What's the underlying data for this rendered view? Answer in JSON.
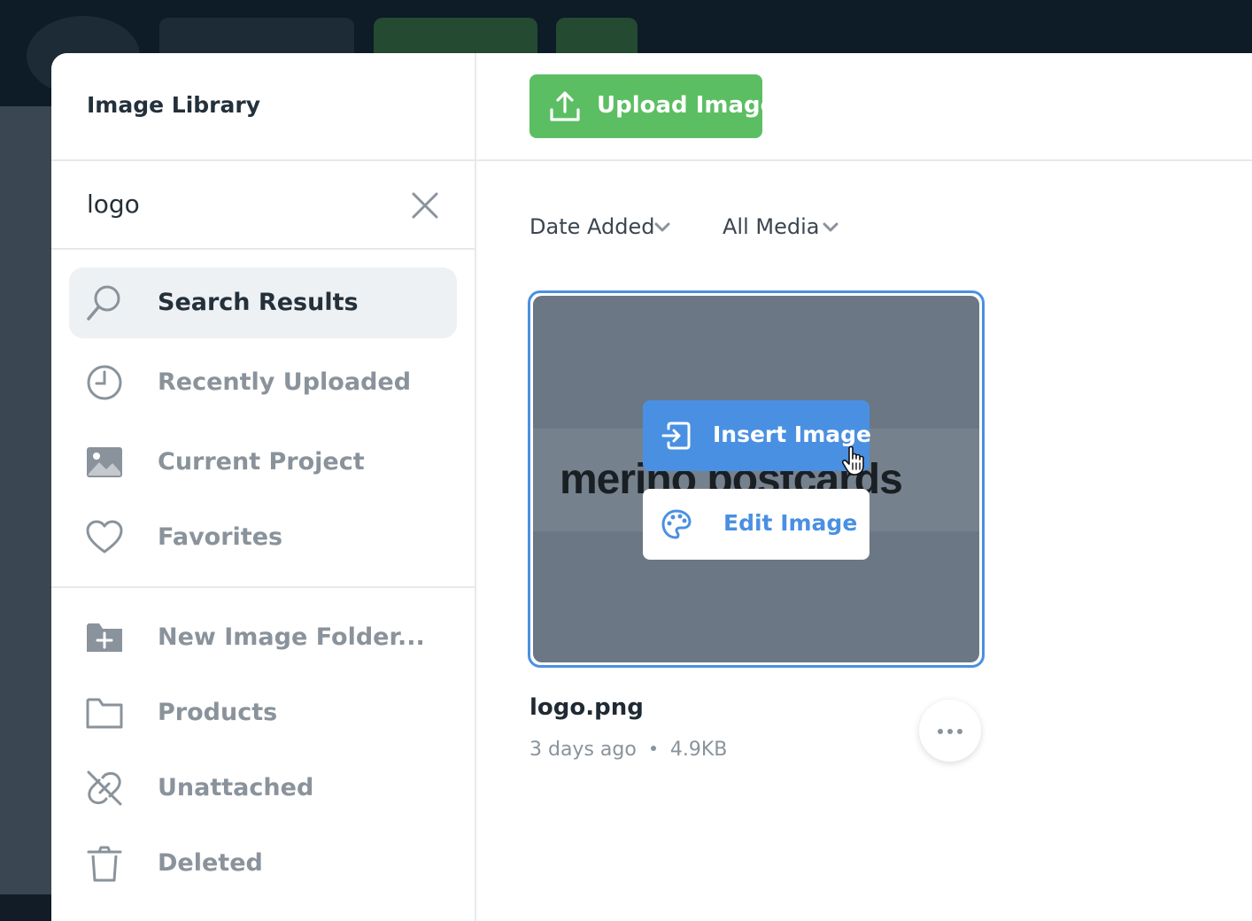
{
  "library": {
    "title": "Image Library",
    "search": {
      "value": "logo",
      "placeholder": ""
    },
    "nav": [
      {
        "label": "Search Results",
        "icon": "search-icon",
        "active": true
      },
      {
        "label": "Recently Uploaded",
        "icon": "clock-icon"
      },
      {
        "label": "Current Project",
        "icon": "image-icon"
      },
      {
        "label": "Favorites",
        "icon": "heart-icon"
      }
    ],
    "folders": [
      {
        "label": "New Image Folder...",
        "icon": "folder-plus-icon"
      },
      {
        "label": "Products",
        "icon": "folder-icon"
      },
      {
        "label": "Unattached",
        "icon": "unlink-icon"
      },
      {
        "label": "Deleted",
        "icon": "trash-icon"
      }
    ]
  },
  "toolbar": {
    "upload_label": "Upload Image"
  },
  "filters": {
    "sort": "Date Added",
    "media": "All Media"
  },
  "image": {
    "thumbnail_text": "merino  postcards",
    "insert_label": "Insert Image",
    "edit_label": "Edit Image",
    "name": "logo.png",
    "age": "3 days ago",
    "size": "4.9KB"
  },
  "colors": {
    "accent": "#4a90e2",
    "upload": "#5cbe63",
    "muted": "#8a939b",
    "text": "#24303a"
  }
}
